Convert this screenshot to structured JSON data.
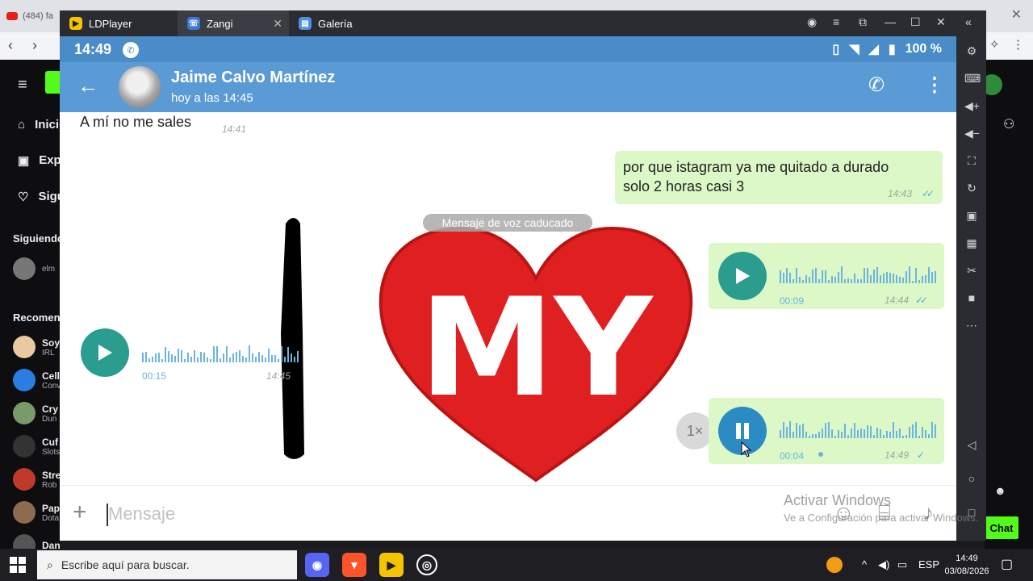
{
  "browser": {
    "tab_label": "(484) fa",
    "ext_tab_label": ""
  },
  "kick": {
    "nav": [
      {
        "icon": "home-icon",
        "label": "Inicio"
      },
      {
        "icon": "explore-icon",
        "label": "Explorar"
      },
      {
        "icon": "heart-icon",
        "label": "Siguiendo"
      }
    ],
    "following_title": "Siguiendo",
    "following_user": "elm",
    "recommended_title": "Recomendados",
    "channels": [
      {
        "name": "Soy",
        "sub": "IRL",
        "color": "#e8c9a0"
      },
      {
        "name": "Cell",
        "sub": "Conv",
        "color": "#2a7de1"
      },
      {
        "name": "Cry",
        "sub": "Dun",
        "color": "#7a9a6a"
      },
      {
        "name": "Cuf",
        "sub": "Slots",
        "color": "#333333"
      },
      {
        "name": "Stre",
        "sub": "Rob",
        "color": "#c0392b"
      },
      {
        "name": "Pap",
        "sub": "Dota",
        "color": "#8e6b4e"
      },
      {
        "name": "Danikongi",
        "sub": "",
        "color": "#555555"
      }
    ],
    "chat_button": "Chat"
  },
  "ldplayer": {
    "tabs": [
      {
        "label": "LDPlayer"
      },
      {
        "label": "Zangi"
      },
      {
        "label": "Galería"
      }
    ]
  },
  "status": {
    "time": "14:49",
    "battery": "100 %"
  },
  "chat_header": {
    "contact_name": "Jaime Calvo Martínez",
    "last_seen": "hoy a las 14:45"
  },
  "messages": {
    "m1": {
      "text": "A mí no me sales",
      "time": "14:41"
    },
    "m2": {
      "text_line1": "por que istagram ya me quitado a durado",
      "text_line2": "solo 2 horas casi 3",
      "time": "14:43"
    },
    "system_label": "Mensaje de voz caducado",
    "voice_in": {
      "duration": "00:15",
      "time": "14:45"
    },
    "voice_out_1": {
      "duration": "00:09",
      "time": "14:44"
    },
    "voice_out_2": {
      "duration": "00:04",
      "time": "14:49",
      "speed": "1×"
    },
    "sticker_text": "MY"
  },
  "composer": {
    "placeholder": "Mensaje"
  },
  "watermark": {
    "line1": "Activar Windows",
    "line2": "Ve a Configuración para activar Windows."
  },
  "taskbar": {
    "search_placeholder": "Escribe aquí para buscar.",
    "language": "ESP",
    "time": "14:49",
    "date": "03/08/2026"
  },
  "colors": {
    "appbar": "#5b9bd5",
    "status_bar": "#4a8cc7",
    "outgoing_bubble": "#dcf8c6",
    "play_button": "#2a9d8f",
    "waveform": "#6cb4e0",
    "kick_green": "#53fc18"
  }
}
